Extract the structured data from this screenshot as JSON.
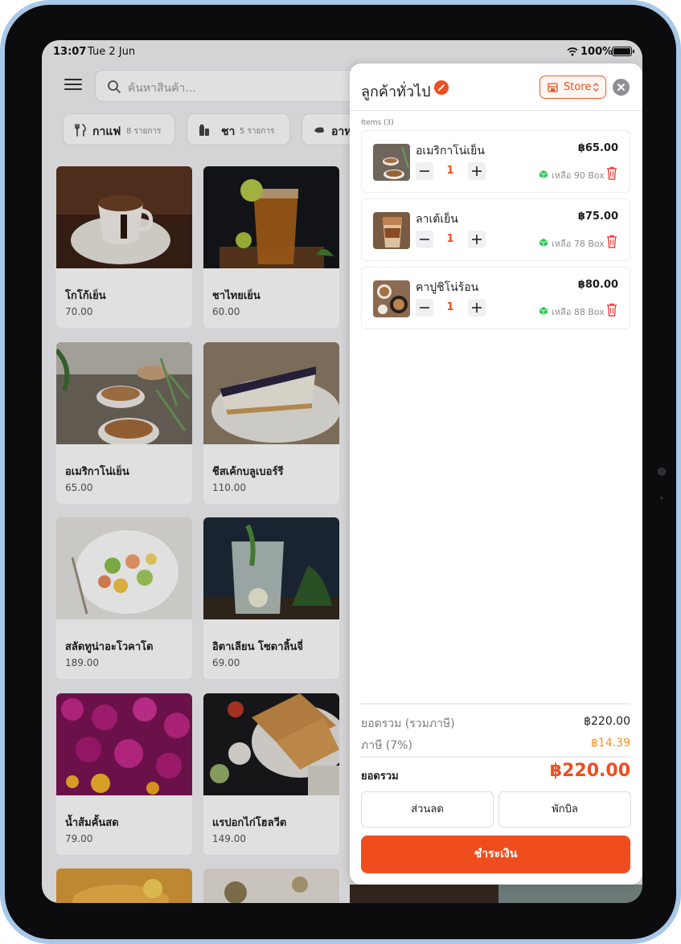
{
  "status_bar": {
    "time": "13:07",
    "date": "Tue 2 Jun",
    "battery": "100%"
  },
  "search": {
    "placeholder": "ค้นหาสินค้า..."
  },
  "categories": [
    {
      "name": "กาแฟ",
      "count": "8 รายการ",
      "icon": "coffee-maker-icon"
    },
    {
      "name": "ชา",
      "count": "5 รายการ",
      "icon": "tea-icon"
    },
    {
      "name": "อาห",
      "count": "",
      "icon": "food-icon"
    }
  ],
  "products": [
    {
      "name": "โกโก้เย็น",
      "price": "70.00"
    },
    {
      "name": "ชาไทยเย็น",
      "price": "60.00"
    },
    {
      "name": "อเมริกาโน่เย็น",
      "price": "65.00"
    },
    {
      "name": "ชีสเค้กบลูเบอร์รี",
      "price": "110.00"
    },
    {
      "name": "สลัดทูน่าอะโวคาโด",
      "price": "189.00"
    },
    {
      "name": "อิตาเลียน โซดาลิ้นจี่",
      "price": "69.00"
    },
    {
      "name": "น้ำส้มคั้นสด",
      "price": "79.00"
    },
    {
      "name": "แรปอกไก่โฮลวีต",
      "price": "149.00"
    }
  ],
  "cart": {
    "customer": "ลูกค้าทั่วไป",
    "store_label": "Store",
    "items_label": "Items (3)",
    "items": [
      {
        "name": "อเมริกาโน่เย็น",
        "price": "฿65.00",
        "qty": "1",
        "stock": "เหลือ 90 Box"
      },
      {
        "name": "ลาเต้เย็น",
        "price": "฿75.00",
        "qty": "1",
        "stock": "เหลือ 78 Box"
      },
      {
        "name": "คาปูชิโน่ร้อน",
        "price": "฿80.00",
        "qty": "1",
        "stock": "เหลือ 88 Box"
      }
    ],
    "subtotal_label": "ยอดรวม (รวมภาษี)",
    "subtotal": "฿220.00",
    "tax_label": "ภาษี (7%)",
    "tax": "฿14.39",
    "total_label": "ยอดรวม",
    "total": "฿220.00",
    "discount_label": "ส่วนลด",
    "hold_label": "พักบิล",
    "pay_label": "ชำระเงิน"
  },
  "colors": {
    "accent": "#f04d1f",
    "tax": "#f0932b",
    "stock": "#34c759"
  }
}
